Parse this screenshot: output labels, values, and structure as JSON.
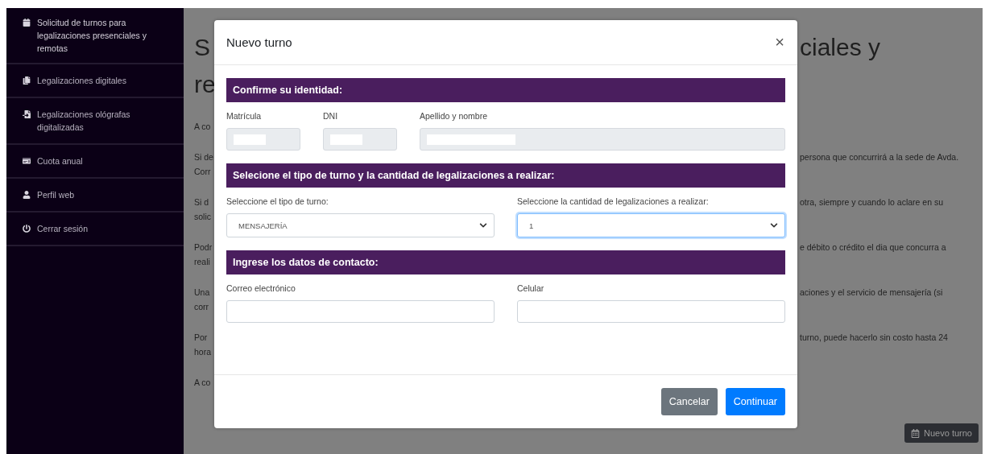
{
  "sidebar": {
    "items": [
      {
        "label": "Solicitud de turnos para legalizaciones presenciales y remotas",
        "selected": true
      },
      {
        "label": "Legalizaciones digitales",
        "selected": false
      },
      {
        "label": "Legalizaciones ológrafas digitalizadas",
        "selected": false
      },
      {
        "label": "Cuota anual",
        "selected": false
      },
      {
        "label": "Perfil web",
        "selected": false
      },
      {
        "label": "Cerrar sesión",
        "selected": false
      }
    ]
  },
  "page": {
    "heading": {
      "left": [
        "S",
        "re"
      ],
      "right": [
        "ciales y"
      ]
    },
    "paragraphs": [
      {
        "left": [
          "A co"
        ]
      },
      {
        "left": [
          "Si de",
          "Corr"
        ],
        "right": [
          "persona que concurrirá a la sede de Avda."
        ]
      },
      {
        "left": [
          "Si d",
          "solic"
        ],
        "right": [
          "otra, siempre y cuando lo aclare en su"
        ]
      },
      {
        "left": [
          "Podr",
          "reali"
        ],
        "right": [
          "e débito o crédito el dia que concurra a"
        ]
      },
      {
        "left": [
          "Una",
          "corr"
        ],
        "right": [
          "aciones y el servicio de mensajería (si"
        ]
      },
      {
        "left": [
          "Por",
          "hora"
        ],
        "right": [
          "turno, puede hacerlo sin costo hasta 24"
        ]
      },
      {
        "left": [
          "A co"
        ]
      }
    ],
    "new_button": "Nuevo turno"
  },
  "modal": {
    "title": "Nuevo turno",
    "close": "×",
    "sections": [
      {
        "title": "Confirme su identidad:",
        "fields": [
          {
            "kind": "input",
            "label": "Matrícula",
            "disabled": true
          },
          {
            "kind": "input",
            "label": "DNI",
            "disabled": true
          },
          {
            "kind": "input",
            "label": "Apellido y nombre",
            "disabled": true
          }
        ]
      },
      {
        "title": "Selecione el tipo de turno y la cantidad de legalizaciones a realizar:",
        "fields": [
          {
            "kind": "select",
            "label": "Seleccione el tipo de turno:",
            "value": "MENSAJERÍA",
            "focused": false
          },
          {
            "kind": "select",
            "label": "Seleccione la cantidad de legalizaciones a realizar:",
            "value": "1",
            "focused": true
          }
        ]
      },
      {
        "title": "Ingrese los datos de contacto:",
        "fields": [
          {
            "kind": "input",
            "label": "Correo electrónico",
            "disabled": false
          },
          {
            "kind": "input",
            "label": "Celular",
            "disabled": false
          }
        ]
      }
    ],
    "buttons": [
      {
        "label": "Cancelar",
        "kind": "secondary"
      },
      {
        "label": "Continuar",
        "kind": "primary"
      }
    ]
  }
}
